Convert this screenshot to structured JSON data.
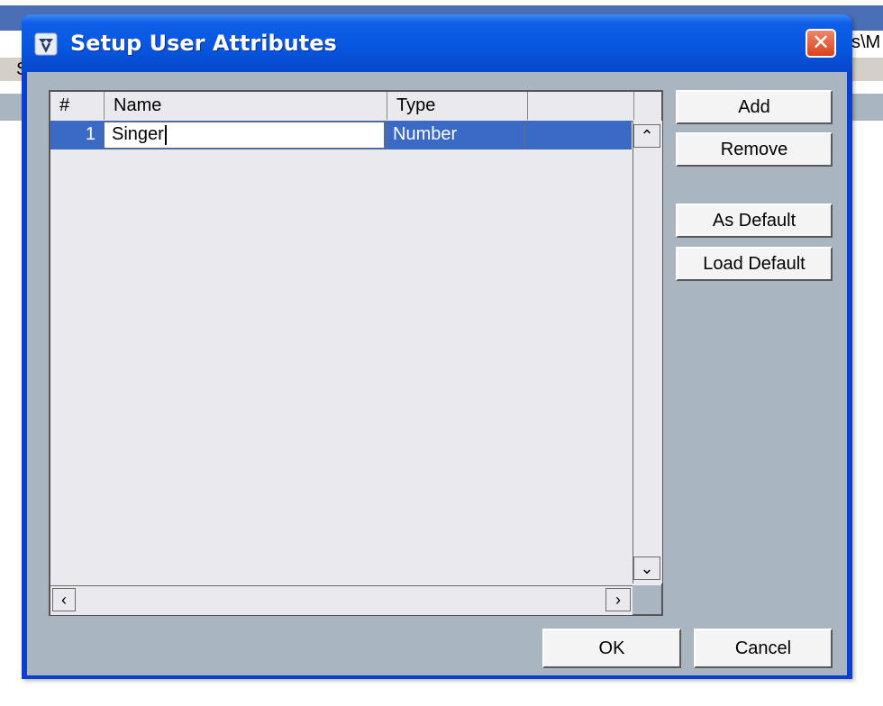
{
  "background": {
    "left_fragment": "S",
    "right_fragment": "s\\M"
  },
  "dialog": {
    "title": "Setup User Attributes",
    "close_label": "✕"
  },
  "table": {
    "headers": [
      "#",
      "Name",
      "Type",
      ""
    ],
    "rows": [
      {
        "num": "1",
        "name": "Singer",
        "type": "Number"
      }
    ]
  },
  "scrollbar": {
    "up": "⌃",
    "down": "⌄",
    "left": "‹",
    "right": "›"
  },
  "buttons": {
    "add": "Add",
    "remove": "Remove",
    "as_default": "As Default",
    "load_default": "Load Default",
    "ok": "OK",
    "cancel": "Cancel"
  },
  "colors": {
    "title_bar": "#0756e0",
    "selection": "#3a6ac6",
    "close": "#d8421c"
  }
}
